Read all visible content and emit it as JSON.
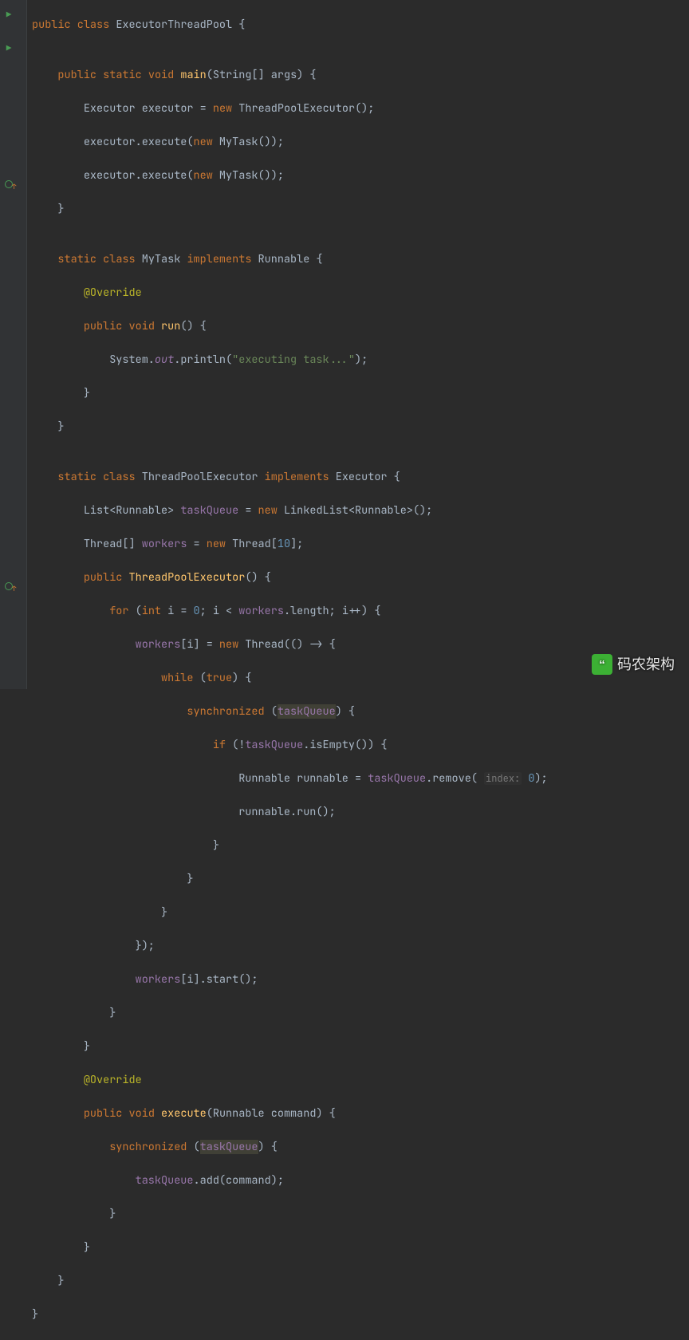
{
  "gutter": {
    "run_icons_lines": [
      0,
      2
    ],
    "override_lines": [
      10,
      34
    ]
  },
  "watermark": {
    "text": "码农架构",
    "icon_glyph": "“"
  },
  "code": {
    "l0": {
      "kw_public": "public",
      "kw_class": "class",
      "cls": "ExecutorThreadPool",
      "brace": " {"
    },
    "l1": "",
    "l2": {
      "kw_public": "public",
      "kw_static": "static",
      "kw_void": "void",
      "method": "main",
      "sig": "(String[] args) {"
    },
    "l3": {
      "type": "Executor",
      "var": "executor",
      "eq": " = ",
      "kw_new": "new",
      "ctor": " ThreadPoolExecutor();"
    },
    "l4": {
      "pre": "executor.execute(",
      "kw_new": "new",
      "post": " MyTask());"
    },
    "l5": {
      "pre": "executor.execute(",
      "kw_new": "new",
      "post": " MyTask());"
    },
    "l6": "}",
    "l7": "",
    "l8": {
      "kw_static": "static",
      "kw_class": "class",
      "cls": " MyTask ",
      "kw_impl": "implements",
      "iface": " Runnable {"
    },
    "l9": {
      "ann": "@Override"
    },
    "l10": {
      "kw_public": "public",
      "kw_void": "void",
      "method": "run",
      "sig": "() {"
    },
    "l11": {
      "pre": "System.",
      "out": "out",
      "mid": ".println(",
      "str": "\"executing task...\"",
      "post": ");"
    },
    "l12": "}",
    "l13": "}",
    "l14": "",
    "l15": {
      "kw_static": "static",
      "kw_class": "class",
      "cls": " ThreadPoolExecutor ",
      "kw_impl": "implements",
      "iface": " Executor {"
    },
    "l16": {
      "pre": "List<Runnable> ",
      "field": "taskQueue",
      "mid": " = ",
      "kw_new": "new",
      "post": " LinkedList<Runnable>();"
    },
    "l17": {
      "pre": "Thread[] ",
      "field": "workers",
      "mid": " = ",
      "kw_new": "new",
      "post": " Thread[",
      "num": "10",
      "end": "];"
    },
    "l18": {
      "kw_public": "public",
      "ctor": "ThreadPoolExecutor",
      "sig": "() {"
    },
    "l19": {
      "kw_for": "for",
      "open": " (",
      "kw_int": "int",
      "var": " i = ",
      "num0": "0",
      "mid": "; i < ",
      "field": "workers",
      "post": ".length; i++) {"
    },
    "l20": {
      "field": "workers",
      "mid": "[i] = ",
      "kw_new": "new",
      "post": " Thread(() -> {"
    },
    "l21": {
      "kw_while": "while",
      "open": " (",
      "kw_true": "true",
      "close": ") {"
    },
    "l22": {
      "kw_sync": "synchronized",
      "open": " (",
      "field": "taskQueue",
      "close": ") {"
    },
    "l23": {
      "kw_if": "if",
      "open": " (!",
      "field": "taskQueue",
      "post": ".isEmpty()) {"
    },
    "l24": {
      "pre": "Runnable runnable = ",
      "field": "taskQueue",
      "mid": ".remove( ",
      "hint": "index:",
      "sp": " ",
      "num": "0",
      "post": ");"
    },
    "l25": "runnable.run();",
    "l26": "}",
    "l27": "}",
    "l28": "}",
    "l29": "});",
    "l30": {
      "field": "workers",
      "post": "[i].start();"
    },
    "l31": "}",
    "l32": "}",
    "l33": {
      "ann": "@Override"
    },
    "l34": {
      "kw_public": "public",
      "kw_void": "void",
      "method": "execute",
      "sig": "(Runnable command) {"
    },
    "l35": {
      "kw_sync": "synchronized",
      "open": " (",
      "field": "taskQueue",
      "close": ") {"
    },
    "l36": {
      "field": "taskQueue",
      "post": ".add(command);"
    },
    "l37": "}",
    "l38": "}",
    "l39": "}",
    "l40": "}"
  }
}
